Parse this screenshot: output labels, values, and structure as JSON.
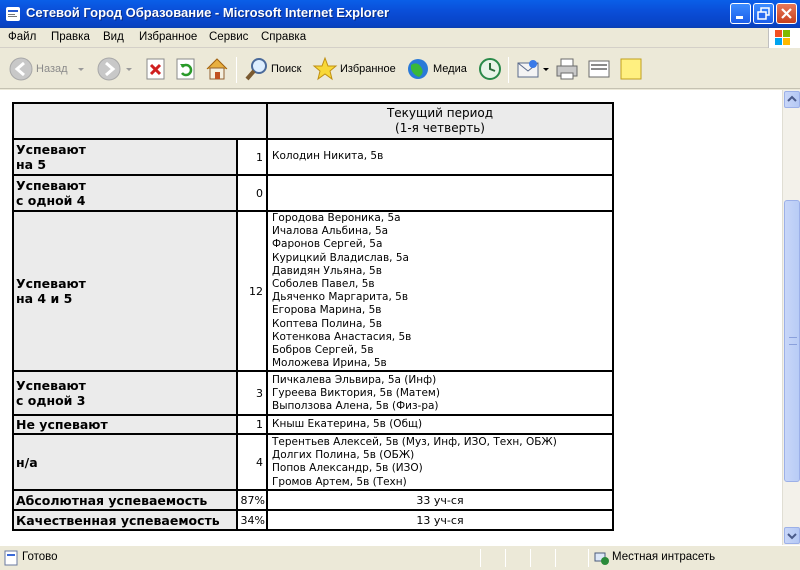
{
  "window": {
    "title": "Сетевой Город Образование - Microsoft Internet Explorer"
  },
  "menu": [
    "Файл",
    "Правка",
    "Вид",
    "Избранное",
    "Сервис",
    "Справка"
  ],
  "toolbar": {
    "back_label": "Назад",
    "search_label": "Поиск",
    "favorites_label": "Избранное",
    "media_label": "Медиа"
  },
  "status": {
    "text": "Готово",
    "zone": "Местная интрасеть"
  },
  "report": {
    "header_line1": "Текущий период",
    "header_line2": "(1-я четверть)",
    "rows": [
      {
        "label1": "Успевают",
        "label2": "на 5",
        "count": "1",
        "names": [
          "Колодин Никита, 5в"
        ]
      },
      {
        "label1": "Успевают",
        "label2": "с одной 4",
        "count": "0",
        "names": []
      },
      {
        "label1": "Успевают",
        "label2": "на 4 и 5",
        "count": "12",
        "names": [
          "Городова Вероника, 5а",
          "Ичалова Альбина, 5а",
          "Фаронов Сергей, 5а",
          "Курицкий Владислав, 5а",
          "Давидян Ульяна, 5в",
          "Соболев Павел, 5в",
          "Дьяченко Маргарита, 5в",
          "Егорова Марина, 5в",
          "Коптева Полина, 5в",
          "Котенкова Анастасия, 5в",
          "Бобров Сергей, 5в",
          "Моложева Ирина, 5в"
        ]
      },
      {
        "label1": "Успевают",
        "label2": "с одной 3",
        "count": "3",
        "names": [
          "Пичкалева Эльвира, 5а (Инф)",
          "Гуреева Виктория, 5в (Матем)",
          "Выползова Алена, 5в (Физ-ра)"
        ]
      },
      {
        "label1": "Не успевают",
        "label2": "",
        "count": "1",
        "names": [
          "Кныш Екатерина, 5в (Общ)"
        ]
      },
      {
        "label1": "н/а",
        "label2": "",
        "count": "4",
        "names": [
          "Терентьев Алексей, 5в (Муз, Инф, ИЗО, Техн, ОБЖ)",
          "Долгих Полина, 5в (ОБЖ)",
          "Попов Александр, 5в (ИЗО)",
          "Громов Артем, 5в (Техн)"
        ]
      }
    ],
    "totals": [
      {
        "label": "Абсолютная успеваемость",
        "percent": "87%",
        "value": "33 уч-ся"
      },
      {
        "label": "Качественная успеваемость",
        "percent": "34%",
        "value": "13 уч-ся"
      }
    ]
  }
}
